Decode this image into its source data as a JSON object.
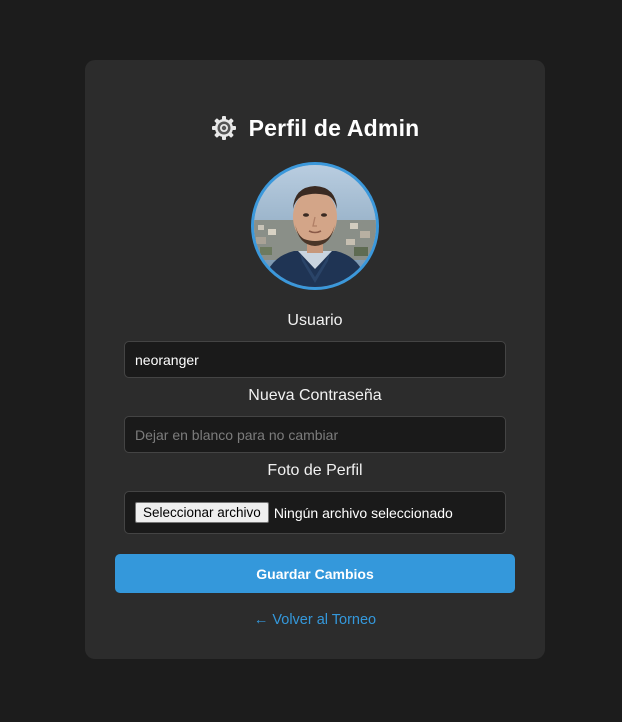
{
  "header": {
    "icon": "gear-icon",
    "title": "Perfil de Admin"
  },
  "avatar": {
    "description_icon": "profile-photo",
    "border_color": "#3b98db"
  },
  "form": {
    "username": {
      "label": "Usuario",
      "value": "neoranger"
    },
    "password": {
      "label": "Nueva Contraseña",
      "value": "",
      "placeholder": "Dejar en blanco para no cambiar"
    },
    "photo": {
      "label": "Foto de Perfil",
      "button_label": "Seleccionar archivo",
      "status": "Ningún archivo seleccionado"
    },
    "submit_label": "Guardar Cambios"
  },
  "footer": {
    "back_link": "← Volver al Torneo"
  },
  "colors": {
    "background": "#1c1c1c",
    "card": "#2c2c2c",
    "accent": "#3498db"
  }
}
